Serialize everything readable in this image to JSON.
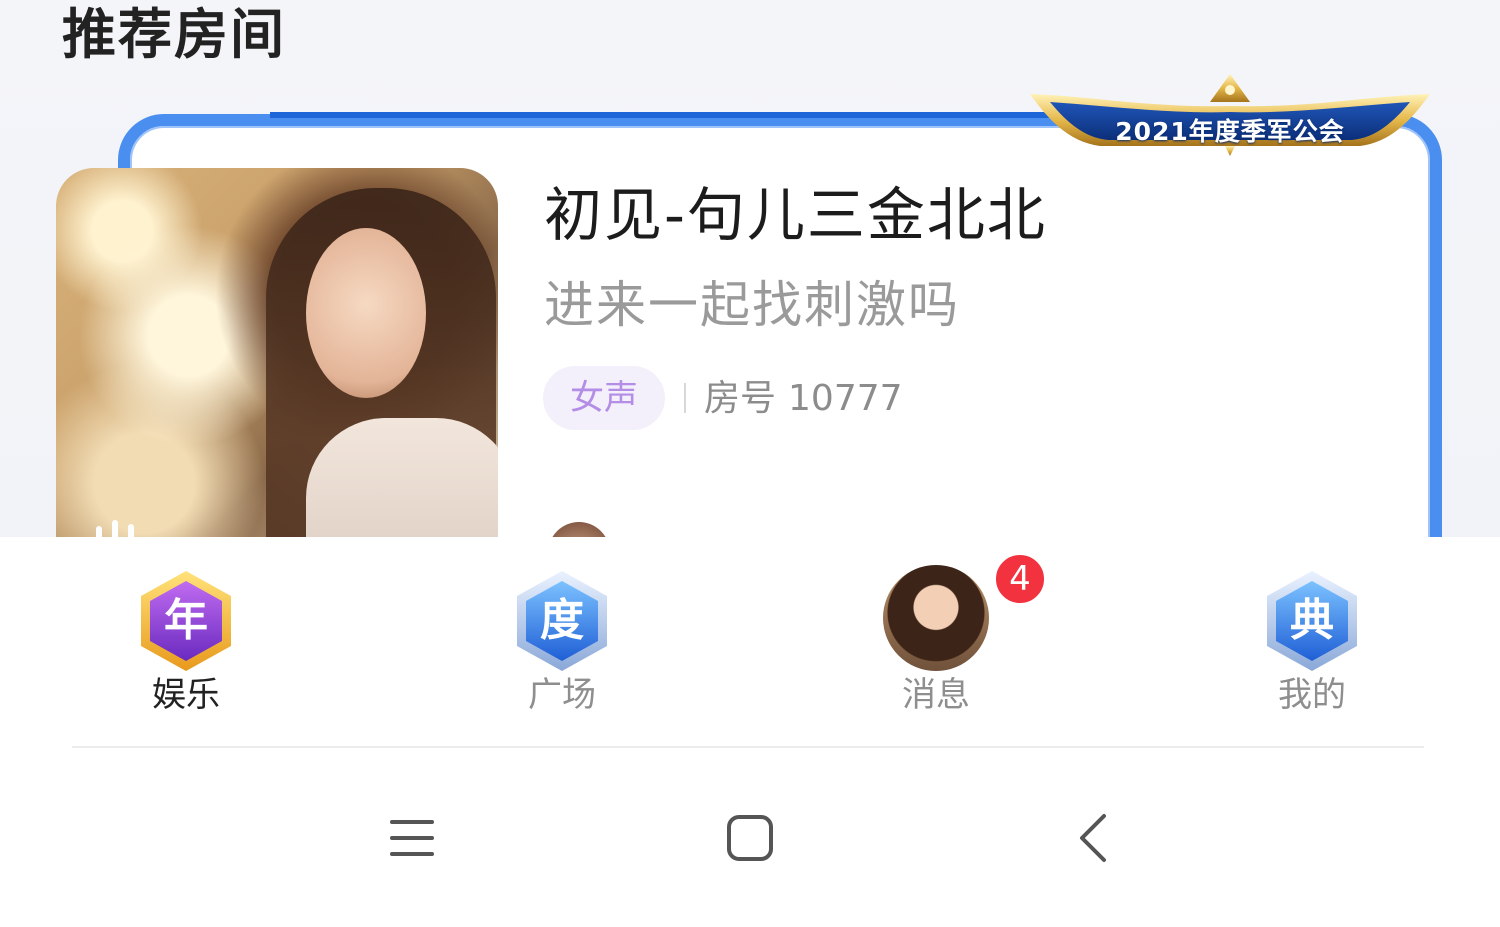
{
  "section": {
    "title": "推荐房间"
  },
  "room": {
    "season_badge": "2021年度季军公会",
    "title": "初见-句儿三金北北",
    "description": "进来一起找刺激吗",
    "tag": "女声",
    "number_label": "房号",
    "number": "10777",
    "accent_color": "#4a8ef0"
  },
  "tabbar": {
    "tabs": [
      {
        "label": "娱乐",
        "icon": "year-badge-icon",
        "icon_char": "年",
        "active": true
      },
      {
        "label": "广场",
        "icon": "degree-badge-icon",
        "icon_char": "度",
        "active": false
      },
      {
        "label": "消息",
        "icon": "avatar-icon",
        "active": false,
        "badge": "4"
      },
      {
        "label": "我的",
        "icon": "classic-badge-icon",
        "icon_char": "典",
        "active": false
      }
    ]
  },
  "system_nav": {
    "buttons": [
      "menu-icon",
      "home-icon",
      "back-icon"
    ]
  }
}
